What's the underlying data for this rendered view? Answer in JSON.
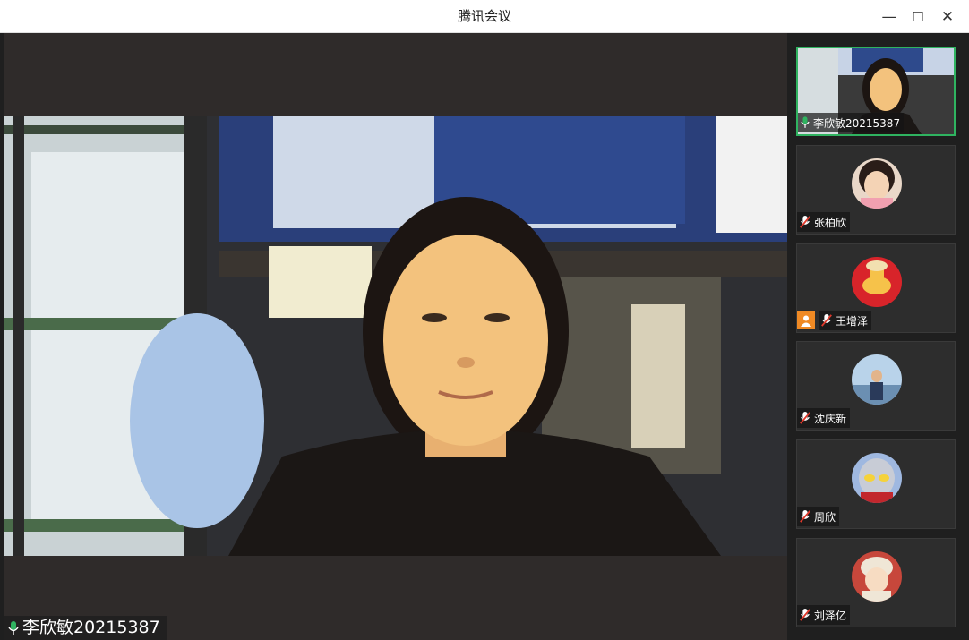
{
  "window": {
    "title": "腾讯会议"
  },
  "window_controls": {
    "minimize": "—",
    "maximize": "☐",
    "close": "✕"
  },
  "main_video": {
    "speaker_name": "李欣敏20215387",
    "mic_state": "active"
  },
  "colors": {
    "active_border": "#2fb360",
    "mic_active": "#2fb360",
    "host_badge": "#f08a24"
  },
  "participants": [
    {
      "name": "李欣敏20215387",
      "mic": "active",
      "type": "video",
      "active": true
    },
    {
      "name": "张柏欣",
      "mic": "muted",
      "type": "avatar"
    },
    {
      "name": "王增泽",
      "mic": "muted",
      "type": "avatar",
      "badge": "host"
    },
    {
      "name": "沈庆新",
      "mic": "muted",
      "type": "avatar"
    },
    {
      "name": "周欣",
      "mic": "muted",
      "type": "avatar"
    },
    {
      "name": "刘泽亿",
      "mic": "muted",
      "type": "avatar"
    }
  ]
}
